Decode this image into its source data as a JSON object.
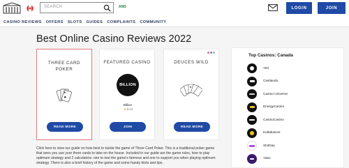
{
  "header": {
    "search_placeholder": "SEARCH",
    "and_label": "AND",
    "login_label": "LOGIN",
    "join_label": "JOIN"
  },
  "nav": {
    "items": [
      {
        "label": "CASINO REVIEWS"
      },
      {
        "label": "OFFERS"
      },
      {
        "label": "SLOTS"
      },
      {
        "label": "GUIDES"
      },
      {
        "label": "COMPLAINTS"
      },
      {
        "label": "COMMUNITY"
      }
    ]
  },
  "page": {
    "title": "Best Online Casino Reviews 2022"
  },
  "cards": [
    {
      "title_line1": "THREE CARD",
      "title_line2": "POKER",
      "button_label": "READ MORE"
    },
    {
      "title": "FEATURED CASINO",
      "casino_name": "Billion",
      "rating": "6.12",
      "logo_text": "BILLION",
      "button_label": "JOIN"
    },
    {
      "title": "DEUCES WILD",
      "button_label": "READ MORE"
    }
  ],
  "sidebar": {
    "title": "Top Casinos: Canada",
    "items": [
      {
        "name": "Yeti",
        "accent": "#ffffff"
      },
      {
        "name": "Casilando",
        "accent": "#ffffff"
      },
      {
        "name": "Casino Universe",
        "accent": "#d8d8d8"
      },
      {
        "name": "EnergyCasino",
        "accent": "#f0c419"
      },
      {
        "name": "CasinoCasino",
        "accent": "#ffffff"
      },
      {
        "name": "Kultakaivos",
        "accent": "#f0c419"
      },
      {
        "name": "SlotDay",
        "accent": "#b04be0"
      },
      {
        "name": "Yako",
        "accent": "#ffffff"
      }
    ]
  },
  "body_text": "Click here to view our guide on how best to tackle the game of Three Card Poker. This is a traditional poker game that sees you use your three cards to take on the house. Included in our guide are the game rules, how to play optimum strategy and 2 calculators: one to test the game's fairness and one to support you when playing optimum strategy. There is also a brief history of the game and some handy hints and tips.",
  "colors": {
    "brand_blue": "#1f4aa6",
    "selected_border": "#e27a7a"
  }
}
